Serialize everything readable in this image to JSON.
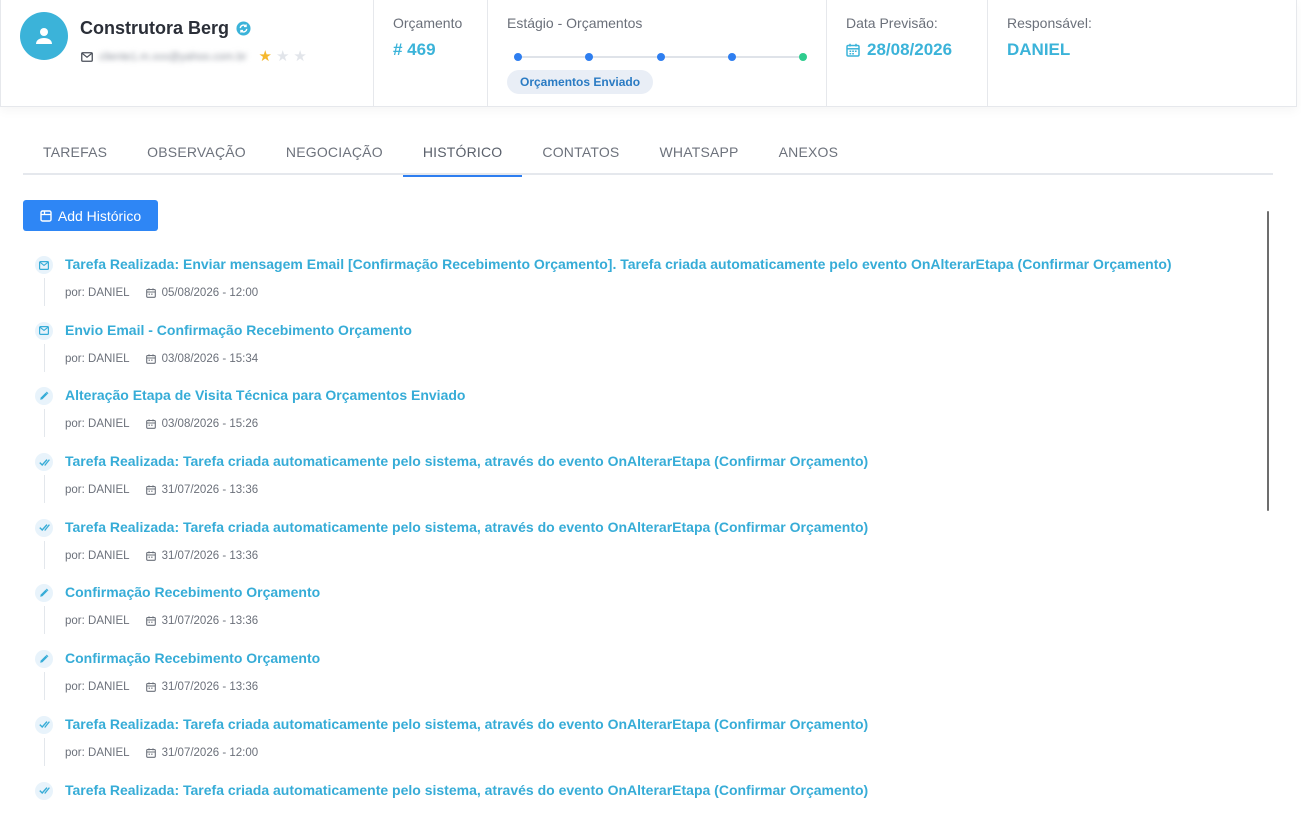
{
  "header": {
    "client_name": "Construtora Berg",
    "client_email": "cliente1.m.xxx@yahoo.com.br",
    "rating": 1,
    "rating_max": 3,
    "orcamento_label": "Orçamento",
    "orcamento_value": "# 469",
    "stage_label": "Estágio - Orçamentos",
    "stage_steps": 5,
    "stage_current": "Orçamentos Enviado",
    "date_label": "Data Previsão:",
    "date_value": "28/08/2026",
    "resp_label": "Responsável:",
    "resp_value": "DANIEL"
  },
  "tabs": [
    {
      "label": "TAREFAS",
      "active": false
    },
    {
      "label": "OBSERVAÇÃO",
      "active": false
    },
    {
      "label": "NEGOCIAÇÃO",
      "active": false
    },
    {
      "label": "HISTÓRICO",
      "active": true
    },
    {
      "label": "CONTATOS",
      "active": false
    },
    {
      "label": "WHATSAPP",
      "active": false
    },
    {
      "label": "ANEXOS",
      "active": false
    }
  ],
  "add_button_label": "Add Histórico",
  "history": [
    {
      "icon": "email-icon",
      "title": "Tarefa Realizada: Enviar mensagem Email [Confirmação Recebimento Orçamento]. Tarefa criada automaticamente pelo evento OnAlterarEtapa (Confirmar Orçamento)",
      "author": "por: DANIEL",
      "date": "05/08/2026 - 12:00"
    },
    {
      "icon": "email-icon",
      "title": "Envio Email - Confirmação Recebimento Orçamento",
      "author": "por: DANIEL",
      "date": "03/08/2026 - 15:34"
    },
    {
      "icon": "pencil-icon",
      "title": "Alteração Etapa de Visita Técnica para Orçamentos Enviado",
      "author": "por: DANIEL",
      "date": "03/08/2026 - 15:26"
    },
    {
      "icon": "double-check-icon",
      "title": "Tarefa Realizada: Tarefa criada automaticamente pelo sistema, através do evento OnAlterarEtapa (Confirmar Orçamento)",
      "author": "por: DANIEL",
      "date": "31/07/2026 - 13:36"
    },
    {
      "icon": "double-check-icon",
      "title": "Tarefa Realizada: Tarefa criada automaticamente pelo sistema, através do evento OnAlterarEtapa (Confirmar Orçamento)",
      "author": "por: DANIEL",
      "date": "31/07/2026 - 13:36"
    },
    {
      "icon": "pencil-icon",
      "title": "Confirmação Recebimento Orçamento",
      "author": "por: DANIEL",
      "date": "31/07/2026 - 13:36"
    },
    {
      "icon": "pencil-icon",
      "title": "Confirmação Recebimento Orçamento",
      "author": "por: DANIEL",
      "date": "31/07/2026 - 13:36"
    },
    {
      "icon": "double-check-icon",
      "title": "Tarefa Realizada: Tarefa criada automaticamente pelo sistema, através do evento OnAlterarEtapa (Confirmar Orçamento)",
      "author": "por: DANIEL",
      "date": "31/07/2026 - 12:00"
    },
    {
      "icon": "double-check-icon",
      "title": "Tarefa Realizada: Tarefa criada automaticamente pelo sistema, através do evento OnAlterarEtapa (Confirmar Orçamento)",
      "author": "",
      "date": ""
    }
  ],
  "colors": {
    "accent": "#36acd7",
    "primary_button": "#2e86f5",
    "stage_dot": "#2e7ef0",
    "stage_dot_done": "#2ecc8e",
    "star_filled": "#f5b82e",
    "star_empty": "#e2e5ea"
  }
}
